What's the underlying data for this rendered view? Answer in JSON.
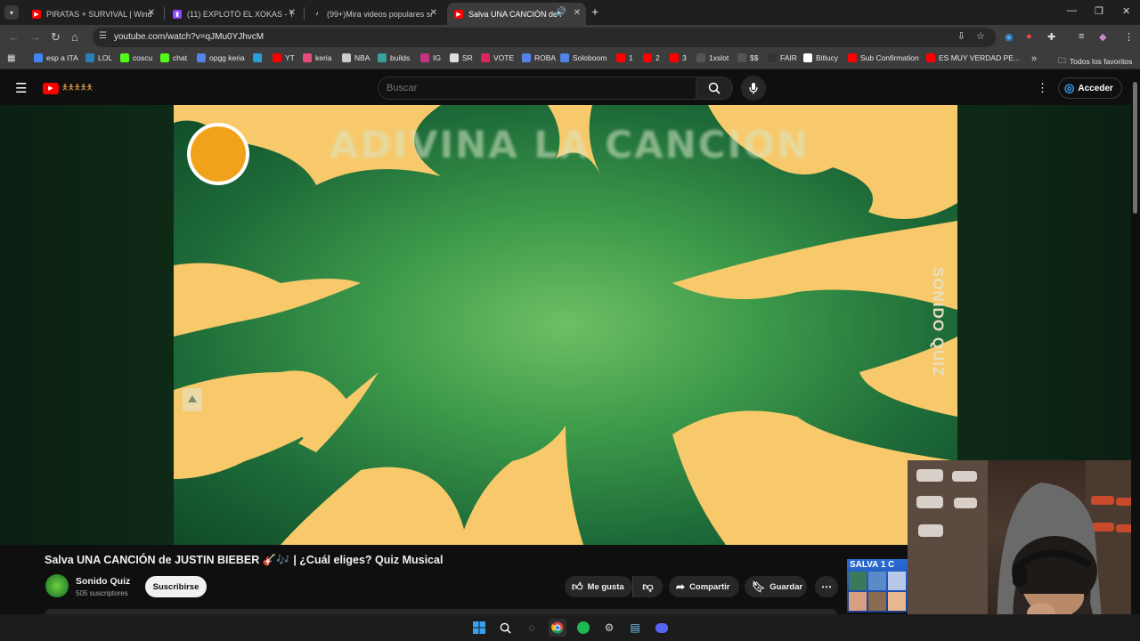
{
  "browser": {
    "tabs": [
      {
        "title": "PIRATAS + SURVIVAL | WindRo",
        "favicon_color": "#ff0000",
        "active": false
      },
      {
        "title": "(11) EXPLOTÓ EL XOKAS - Twitc",
        "favicon_color": "#9146ff",
        "active": false
      },
      {
        "title": "(99+)Mira videos populares sob",
        "favicon_color": "#ffffff",
        "active": false
      },
      {
        "title": "Salva UNA CANCIÓN de JUSTIN",
        "favicon_color": "#ff0000",
        "active": true
      }
    ],
    "url": "youtube.com/watch?v=qJMu0YJhvcM",
    "bookmarks": [
      {
        "label": "esp a ITA",
        "color": "#4285f4"
      },
      {
        "label": "LOL",
        "color": "#2a7fb8"
      },
      {
        "label": "coscu",
        "color": "#53fc18"
      },
      {
        "label": "chat",
        "color": "#53fc18"
      },
      {
        "label": "opgg keria",
        "color": "#5383e8"
      },
      {
        "label": "",
        "color": "#2a9fd6"
      },
      {
        "label": "YT",
        "color": "#ff0000"
      },
      {
        "label": "keria",
        "color": "#e84a7a"
      },
      {
        "label": "NBA",
        "color": "#cccccc"
      },
      {
        "label": "builds",
        "color": "#3aa0a0"
      },
      {
        "label": "IG",
        "color": "#c13584"
      },
      {
        "label": "SR",
        "color": "#dddddd"
      },
      {
        "label": "VOTE",
        "color": "#e0245e"
      },
      {
        "label": "ROBA",
        "color": "#5383e8"
      },
      {
        "label": "Soloboom",
        "color": "#5383e8"
      },
      {
        "label": "1",
        "color": "#ff0000"
      },
      {
        "label": "2",
        "color": "#ff0000"
      },
      {
        "label": "3",
        "color": "#ff0000"
      },
      {
        "label": "1xslot",
        "color": "#555555"
      },
      {
        "label": "$$",
        "color": "#555555"
      },
      {
        "label": "FAIR",
        "color": "#333333"
      },
      {
        "label": "Bitlucy",
        "color": "#ffffff"
      },
      {
        "label": "Sub Confirmation",
        "color": "#ff0000"
      },
      {
        "label": "ES MUY VERDAD PE...",
        "color": "#ff0000"
      }
    ],
    "bookmarks_more": "»",
    "all_bookmarks": "Todos los favoritos"
  },
  "youtube": {
    "search_placeholder": "Buscar",
    "signin_label": "Acceder",
    "video_overlay_title": "ADIVINA LA CANCION",
    "video_side_text": "SONIDO QUIZ",
    "video_title": "Salva UNA CANCIÓN de JUSTIN BIEBER 🎸🎶 | ¿Cuál eliges? Quiz Musical",
    "channel_name": "Sonido Quiz",
    "subscribers": "505 suscriptores",
    "subscribe_label": "Suscribirse",
    "like_label": "Me gusta",
    "share_label": "Compartir",
    "save_label": "Guardar",
    "thumbnail_text": "SALVA 1 C"
  },
  "colors": {
    "accent": "#ff0000",
    "background": "#0f0f0f",
    "video_green": "#3c9a4a",
    "blob_yellow": "#f7c96b"
  }
}
